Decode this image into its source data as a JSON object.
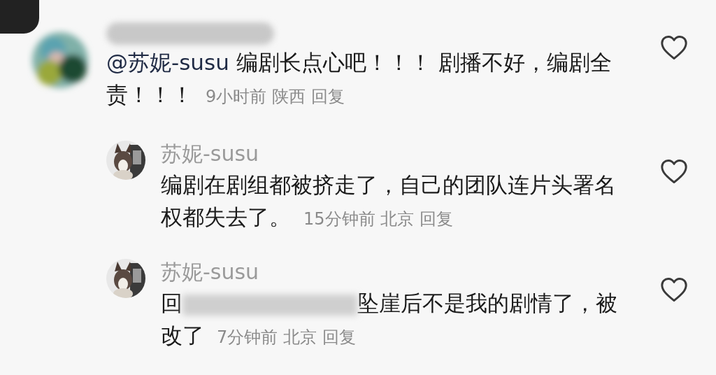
{
  "comments": [
    {
      "kind": "comment",
      "name_blurred": true,
      "mention": "@苏妮-susu",
      "text": "编剧长点心吧！！！  剧播不好，编剧全责！！！",
      "time": "9小时前",
      "location": "陕西",
      "reply_label": "回复",
      "liked": false
    },
    {
      "kind": "reply",
      "name": "苏妮-susu",
      "text": "编剧在剧组都被挤走了，自己的团队连片头署名权都失去了。",
      "time": "15分钟前",
      "location": "北京",
      "reply_label": "回复",
      "liked": false
    },
    {
      "kind": "reply",
      "name": "苏妮-susu",
      "prefix": "回",
      "text_blurred": true,
      "text": "坠崖后不是我的剧情了，被改了",
      "time": "7分钟前",
      "location": "北京",
      "reply_label": "回复",
      "liked": false
    }
  ]
}
